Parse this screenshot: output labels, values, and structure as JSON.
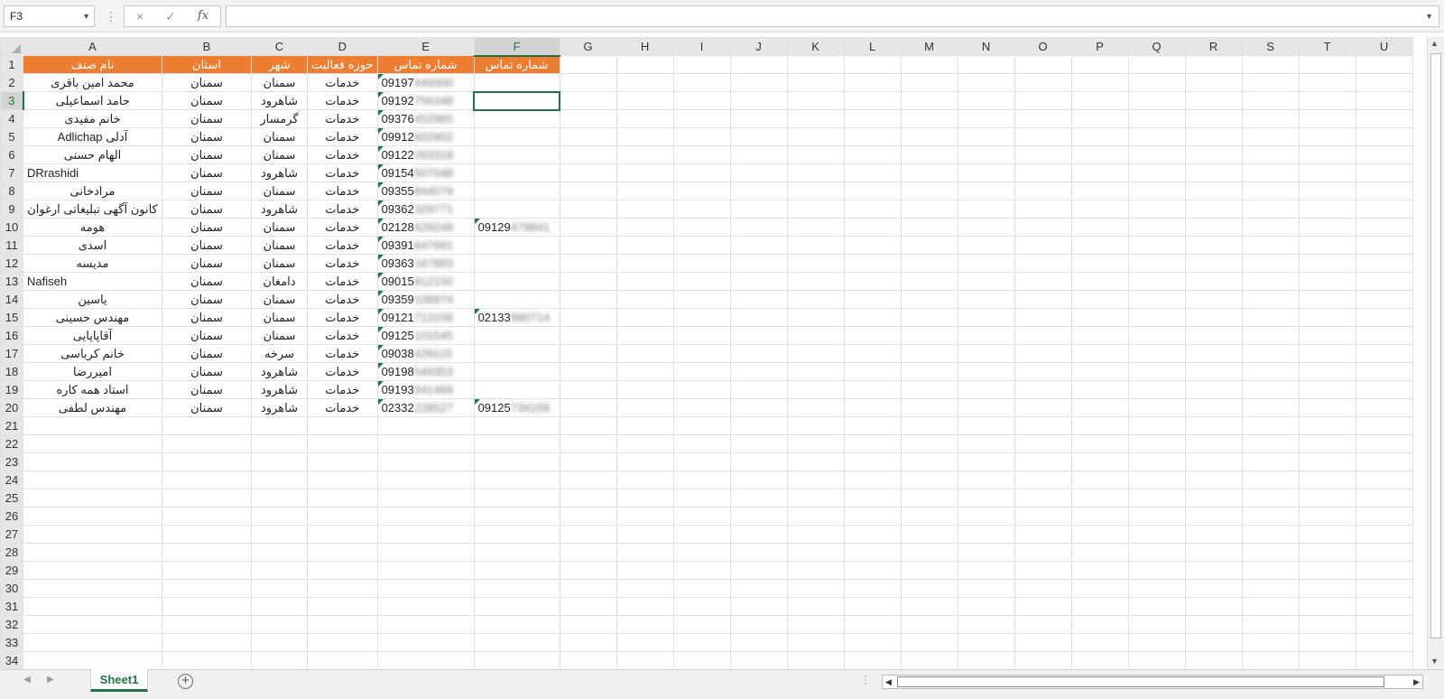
{
  "formula_bar": {
    "name_box": "F3",
    "cancel_icon": "×",
    "enter_icon": "✓",
    "fx_label": "fx",
    "formula_value": ""
  },
  "columns": [
    "A",
    "B",
    "C",
    "D",
    "E",
    "F",
    "G",
    "H",
    "I",
    "J",
    "K",
    "L",
    "M",
    "N",
    "O",
    "P",
    "Q",
    "R",
    "S",
    "T",
    "U"
  ],
  "active_column": "F",
  "active_row": 3,
  "header_row": [
    "نام صنف",
    "استان",
    "شهر",
    "حوزه فعالیت",
    "شماره تماس",
    "شماره تماس"
  ],
  "rows": [
    {
      "name": "محمد امین باقری",
      "province": "سمنان",
      "city": "سمنان",
      "field": "خدمات",
      "phone": "09197449300",
      "phone2": ""
    },
    {
      "name": "حامد اسماعیلی",
      "province": "سمنان",
      "city": "شاهرود",
      "field": "خدمات",
      "phone": "09192756348",
      "phone2": ""
    },
    {
      "name": "خانم مفیدی",
      "province": "سمنان",
      "city": "گرمسار",
      "field": "خدمات",
      "phone": "09376452965",
      "phone2": ""
    },
    {
      "name": "آدلی Adlichap",
      "province": "سمنان",
      "city": "سمنان",
      "field": "خدمات",
      "phone": "09912602902",
      "phone2": ""
    },
    {
      "name": "الهام حسنی",
      "province": "سمنان",
      "city": "سمنان",
      "field": "خدمات",
      "phone": "09122093318",
      "phone2": ""
    },
    {
      "name": "DRrashidi",
      "province": "سمنان",
      "city": "شاهرود",
      "field": "خدمات",
      "phone": "09154507048",
      "phone2": ""
    },
    {
      "name": "مرادخانی",
      "province": "سمنان",
      "city": "سمنان",
      "field": "خدمات",
      "phone": "09355844079",
      "phone2": ""
    },
    {
      "name": "کانون آگهی تبلیغاتی ارغوان",
      "province": "سمنان",
      "city": "شاهرود",
      "field": "خدمات",
      "phone": "09362329771",
      "phone2": ""
    },
    {
      "name": "هومه",
      "province": "سمنان",
      "city": "سمنان",
      "field": "خدمات",
      "phone": "02128429248",
      "phone2": "09129479841"
    },
    {
      "name": "اسدی",
      "province": "سمنان",
      "city": "سمنان",
      "field": "خدمات",
      "phone": "09391647691",
      "phone2": ""
    },
    {
      "name": "مدیسه",
      "province": "سمنان",
      "city": "سمنان",
      "field": "خدمات",
      "phone": "09363167883",
      "phone2": ""
    },
    {
      "name": "Nafiseh",
      "province": "سمنان",
      "city": "دامغان",
      "field": "خدمات",
      "phone": "09015912150",
      "phone2": ""
    },
    {
      "name": "یاسین",
      "province": "سمنان",
      "city": "سمنان",
      "field": "خدمات",
      "phone": "09359108974",
      "phone2": ""
    },
    {
      "name": "مهندس حسینی",
      "province": "سمنان",
      "city": "سمنان",
      "field": "خدمات",
      "phone": "09121713106",
      "phone2": "02133990714"
    },
    {
      "name": "آقاپاپایی",
      "province": "سمنان",
      "city": "سمنان",
      "field": "خدمات",
      "phone": "09125101545",
      "phone2": ""
    },
    {
      "name": "خانم کرباسی",
      "province": "سمنان",
      "city": "سرخه",
      "field": "خدمات",
      "phone": "09038429115",
      "phone2": ""
    },
    {
      "name": "امیررضا",
      "province": "سمنان",
      "city": "شاهرود",
      "field": "خدمات",
      "phone": "09198549353",
      "phone2": ""
    },
    {
      "name": "استاد همه کاره",
      "province": "سمنان",
      "city": "شاهرود",
      "field": "خدمات",
      "phone": "09193341469",
      "phone2": ""
    },
    {
      "name": "مهندس لطفی",
      "province": "سمنان",
      "city": "شاهرود",
      "field": "خدمات",
      "phone": "02332228527",
      "phone2": "09125734159"
    }
  ],
  "total_rows": 34,
  "sheet_tabs": [
    "Sheet1"
  ],
  "add_sheet_icon": "+"
}
